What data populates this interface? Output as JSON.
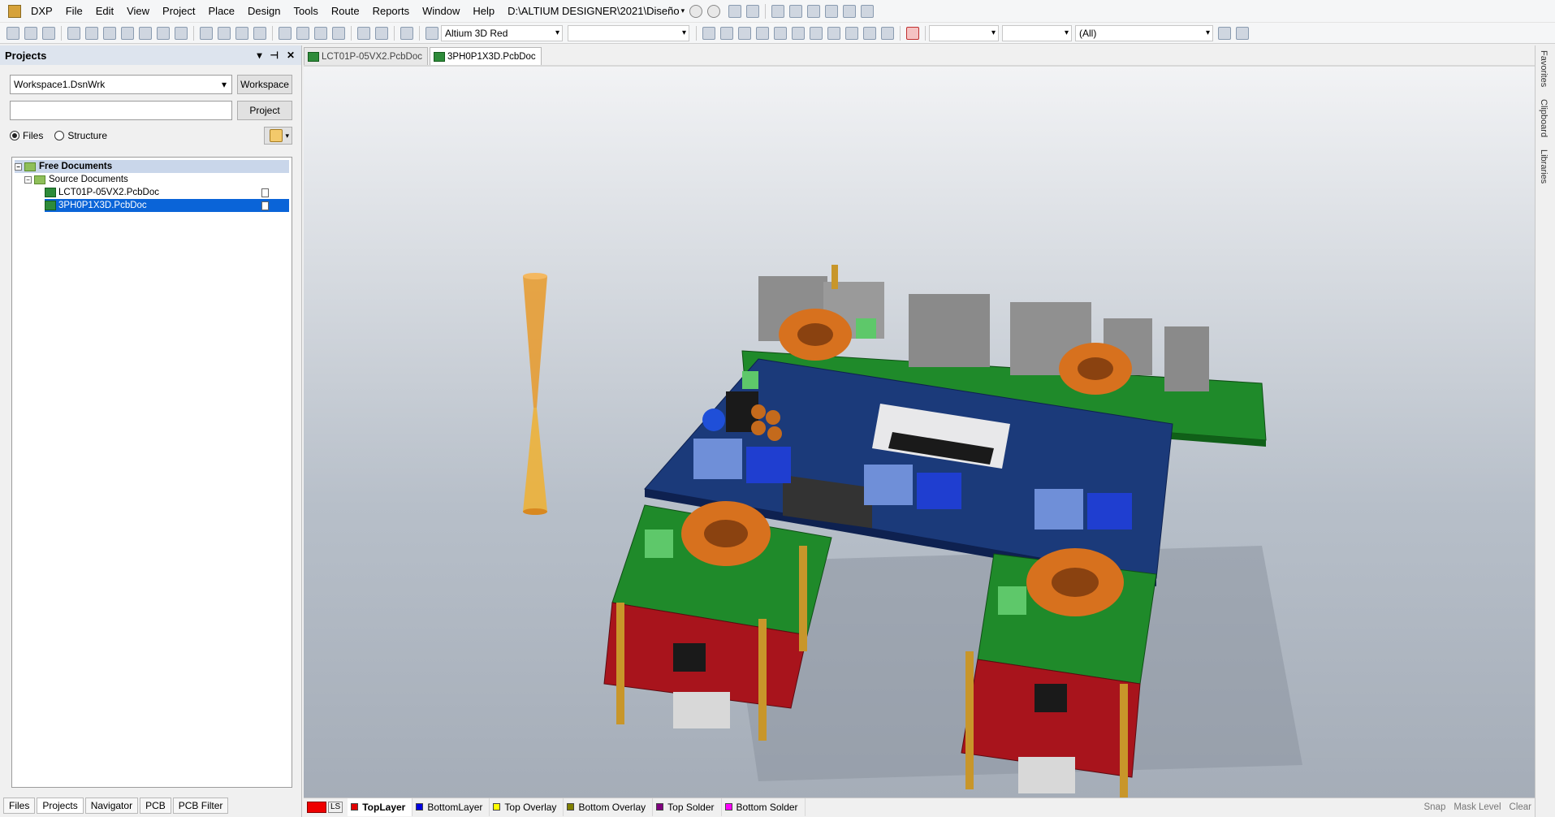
{
  "menu": {
    "items": [
      "DXP",
      "File",
      "Edit",
      "View",
      "Project",
      "Place",
      "Design",
      "Tools",
      "Route",
      "Reports",
      "Window",
      "Help"
    ],
    "path": "D:\\ALTIUM DESIGNER\\2021\\Diseño"
  },
  "toolbar": {
    "view_config": "Altium 3D Red",
    "combo2": "",
    "combo3": "",
    "combo4": "",
    "filter": "(All)"
  },
  "projects_panel": {
    "title": "Projects",
    "workspace_value": "Workspace1.DsnWrk",
    "workspace_button": "Workspace",
    "project_input": "",
    "project_button": "Project",
    "radio_files": "Files",
    "radio_structure": "Structure",
    "tree": {
      "root": "Free Documents",
      "folder": "Source Documents",
      "files": [
        "LCT01P-05VX2.PcbDoc",
        "3PH0P1X3D.PcbDoc"
      ]
    },
    "bottom_tabs": [
      "Files",
      "Projects",
      "Navigator",
      "PCB",
      "PCB Filter"
    ]
  },
  "doc_tabs": [
    "LCT01P-05VX2.PcbDoc",
    "3PH0P1X3D.PcbDoc"
  ],
  "right_panel_tabs": [
    "Favorites",
    "Clipboard",
    "Libraries"
  ],
  "layer_bar": {
    "ls_label": "LS",
    "layers": [
      {
        "name": "TopLayer",
        "color": "#e00000"
      },
      {
        "name": "BottomLayer",
        "color": "#0000e0"
      },
      {
        "name": "Top Overlay",
        "color": "#ffff00"
      },
      {
        "name": "Bottom Overlay",
        "color": "#808000"
      },
      {
        "name": "Top Solder",
        "color": "#800080"
      },
      {
        "name": "Bottom Solder",
        "color": "#ff00ff"
      }
    ],
    "status": [
      "Snap",
      "Mask Level",
      "Clear"
    ]
  },
  "colors": {
    "selection": "#0a64d8",
    "board_green": "#1f8a2a",
    "board_blue": "#1b3a7a",
    "board_red": "#a8141c"
  }
}
